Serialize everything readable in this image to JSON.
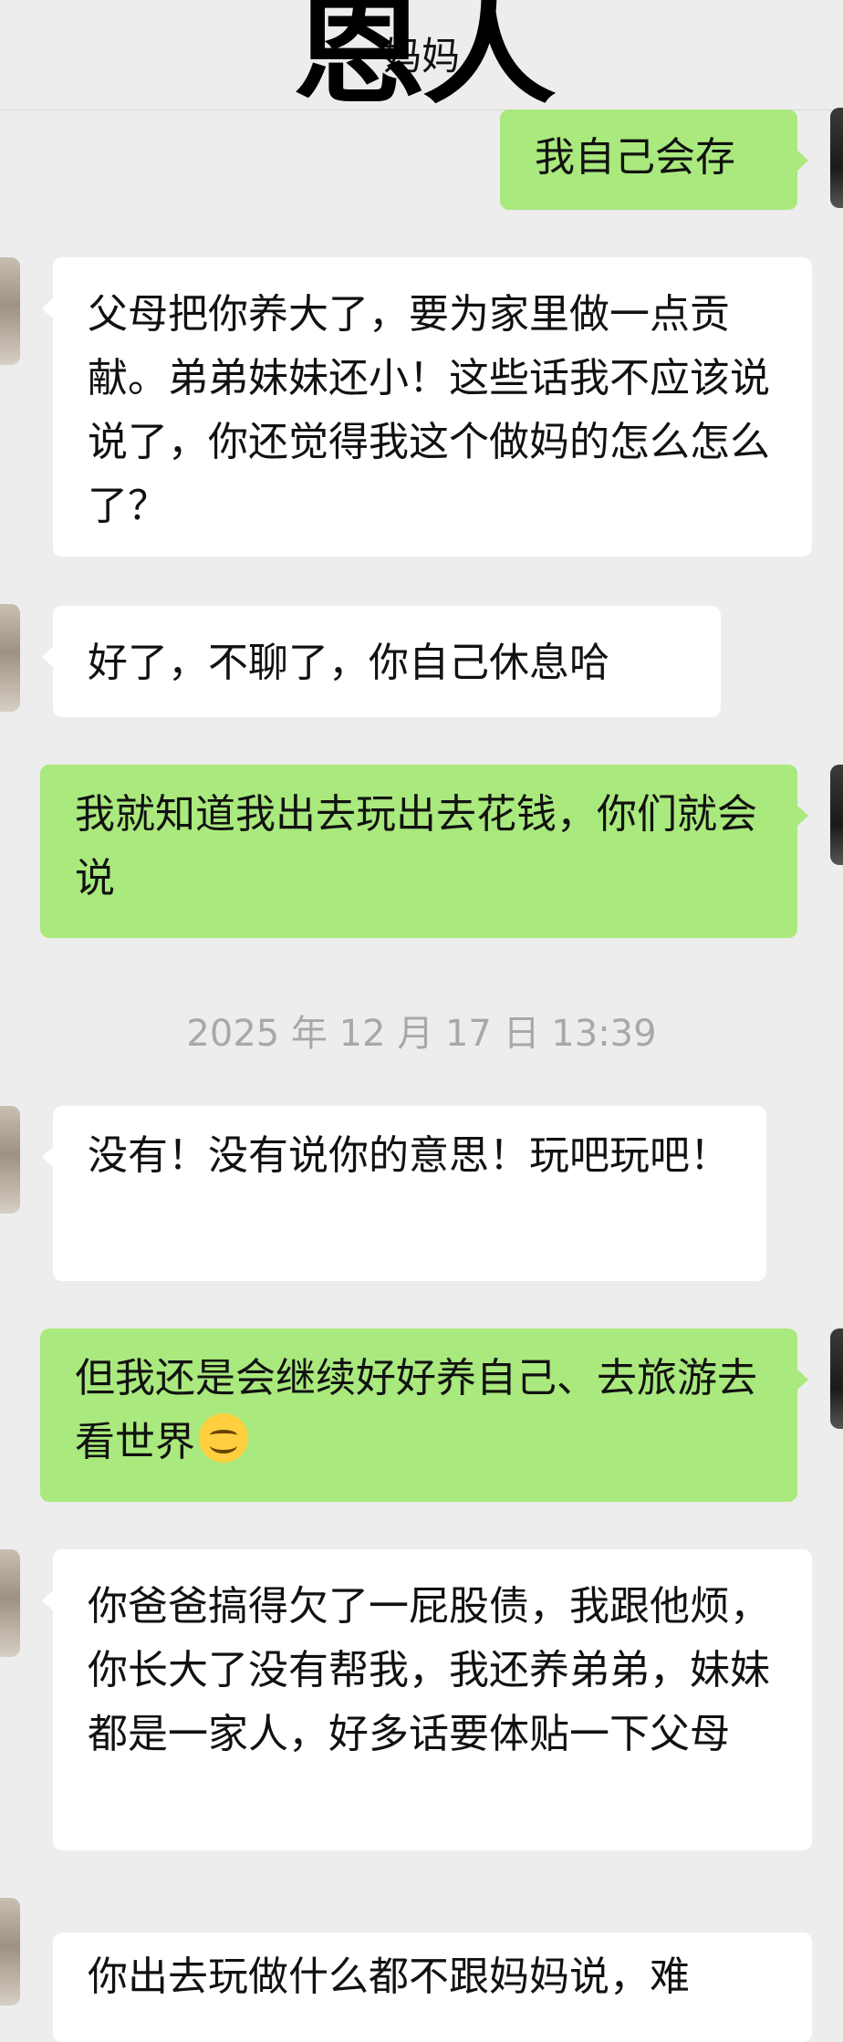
{
  "header": {
    "contact_name": "妈妈",
    "overlay_title": "恩人"
  },
  "messages": [
    {
      "side": "out",
      "text": "我自己会存"
    },
    {
      "side": "in",
      "text": "父母把你养大了，要为家里做一点贡献。弟弟妹妹还小！这些话我不应该说说了，你还觉得我这个做妈的怎么怎么了？"
    },
    {
      "side": "in",
      "text": "好了，不聊了，你自己休息哈"
    },
    {
      "side": "out",
      "text": "我就知道我出去玩出去花钱，你们就会说"
    },
    {
      "side": "in",
      "text": "没有！没有说你的意思！玩吧玩吧！"
    },
    {
      "side": "out",
      "text": "但我还是会继续好好养自己、去旅游去看世界",
      "emoji": "smiling-face-emoji"
    },
    {
      "side": "in",
      "text": "你爸爸搞得欠了一屁股债，我跟他烦，你长大了没有帮我，我还养弟弟，妹妹都是一家人，好多话要体贴一下父母"
    },
    {
      "side": "in",
      "text": "你出去玩做什么都不跟妈妈说，难"
    }
  ],
  "timestamp": "2025 年 12 月 17 日 13:39",
  "colors": {
    "background": "#ededed",
    "incoming_bubble": "#ffffff",
    "outgoing_bubble": "#a9e97d",
    "timestamp_text": "#a8a8a8"
  }
}
